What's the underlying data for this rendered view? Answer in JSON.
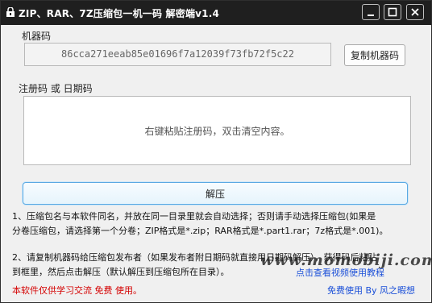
{
  "window": {
    "title": "ZIP、RAR、7Z压缩包一机一码    解密端v1.4"
  },
  "machine": {
    "label": "机器码",
    "value": "86cca271eeab85e01696f7a12039f73fb72f5c22",
    "copy_button": "复制机器码"
  },
  "register": {
    "label": "注册码 或 日期码",
    "placeholder": "右键粘贴注册码，双击清空内容。"
  },
  "decompress_button": "解压",
  "info": {
    "line1": "1、压缩包名与本软件同名，并放在同一目录里就会自动选择；否则请手动选择压缩包(如果是",
    "line2": "分卷压缩包，请选择第一个分卷；ZIP格式是*.zip；RAR格式是*.part1.rar；7z格式是*.001)。",
    "line3": "2、请复制机器码给压缩包发布者（如果发布者附日期码就直接用日期码解压），获得码后粘贴",
    "line4": "到框里，然后点击解压（默认解压到压缩包所在目录）。"
  },
  "watermark": "www.momobiji.com",
  "footer": {
    "notice": "本软件仅供学习交流  免费  使用。",
    "video_link": "点击查看视频使用教程",
    "credit": "免费使用 By 风之暇想"
  },
  "colors": {
    "titlebar": "#1f1f1f",
    "notice_red": "#d40000",
    "link_blue": "#1a4fd8",
    "accent_border": "#5aa9e3"
  }
}
